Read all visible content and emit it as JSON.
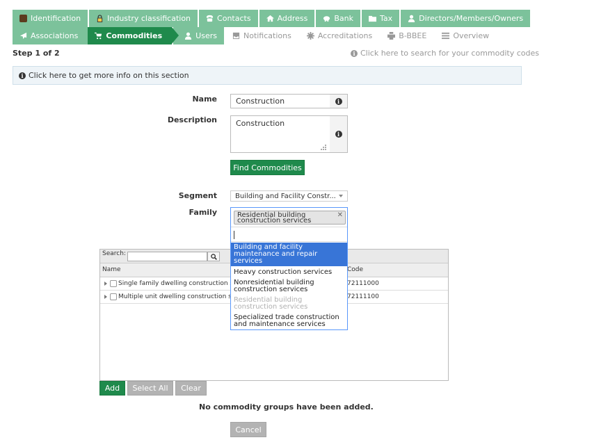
{
  "tabs_row1": [
    {
      "label": "Identification",
      "icon": "briefcase-icon"
    },
    {
      "label": "Industry classification",
      "icon": "lock-icon"
    },
    {
      "label": "Contacts",
      "icon": "phone-icon"
    },
    {
      "label": "Address",
      "icon": "home-icon"
    },
    {
      "label": "Bank",
      "icon": "bank-icon"
    },
    {
      "label": "Tax",
      "icon": "folder-icon"
    },
    {
      "label": "Directors/Members/Owners",
      "icon": "user-icon"
    }
  ],
  "tabs_row2": [
    {
      "label": "Associations",
      "icon": "plane-icon"
    },
    {
      "label": "Commodities",
      "icon": "cart-icon"
    },
    {
      "label": "Users",
      "icon": "user-icon"
    },
    {
      "label": "Notifications",
      "icon": "inbox-icon"
    },
    {
      "label": "Accreditations",
      "icon": "gear-icon"
    },
    {
      "label": "B-BBEE",
      "icon": "print-icon"
    },
    {
      "label": "Overview",
      "icon": "list-icon"
    }
  ],
  "step_label": "Step 1 of 2",
  "search_link": "Click here to search for your commodity codes",
  "info_bar": "Click here to get more info on this section",
  "form": {
    "name_label": "Name",
    "name_value": "Construction",
    "description_label": "Description",
    "description_value": "Construction",
    "find_button": "Find Commodities",
    "segment_label": "Segment",
    "segment_value": "Building and Facility Constr...",
    "family_label": "Family",
    "family_selected": "Residential building construction services"
  },
  "family_options": [
    {
      "label": "Building and facility maintenance and repair services",
      "state": "highlighted"
    },
    {
      "label": "Heavy construction services",
      "state": "normal"
    },
    {
      "label": "Nonresidential building construction services",
      "state": "normal"
    },
    {
      "label": "Residential building construction services",
      "state": "disabled"
    },
    {
      "label": "Specialized trade construction and maintenance services",
      "state": "normal"
    }
  ],
  "grid": {
    "search_label": "Search:",
    "columns": [
      "Name",
      "Code"
    ],
    "rows": [
      {
        "name": "Single family dwelling construction servi",
        "code": "72111000"
      },
      {
        "name": "Multiple unit dwelling construction servic",
        "code": "72111100"
      }
    ]
  },
  "buttons": {
    "add": "Add",
    "select_all": "Select All",
    "clear": "Clear",
    "cancel": "Cancel"
  },
  "empty_message": "No commodity groups have been added.",
  "colors": {
    "tab_green": "#7cc29b",
    "active_green": "#1f8a4c",
    "highlight_blue": "#3875d7"
  }
}
